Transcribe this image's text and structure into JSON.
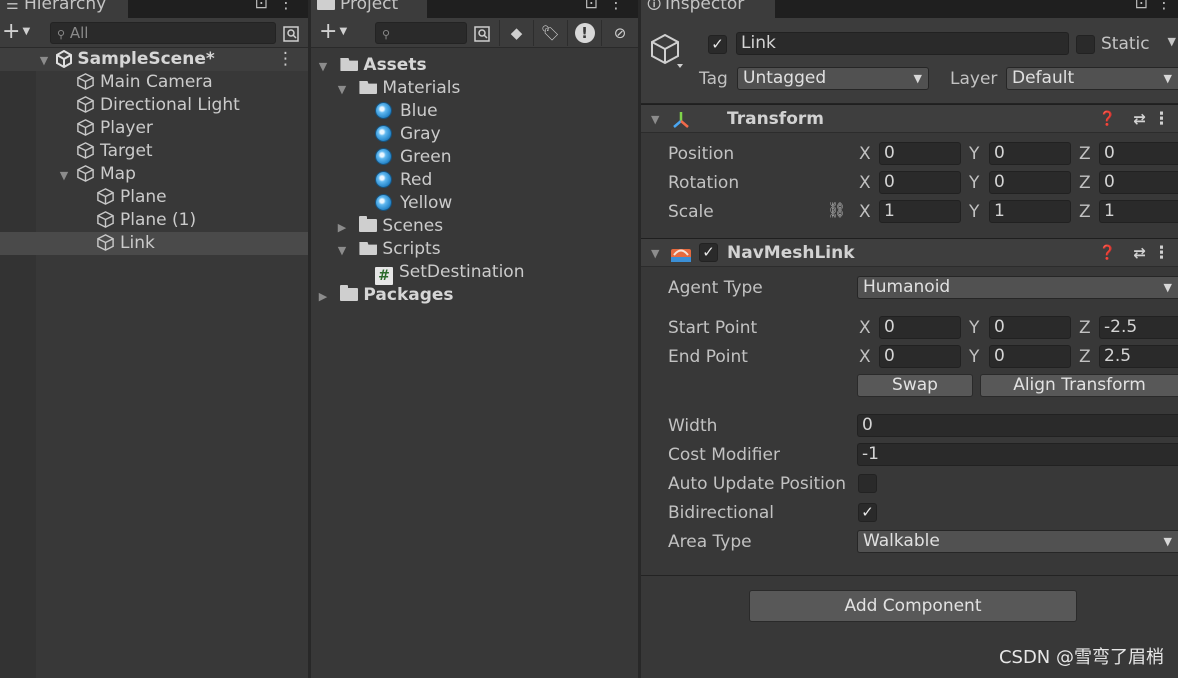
{
  "hierarchy": {
    "tab_label": "Hierarchy",
    "search_placeholder": "All",
    "scene": "SampleScene*",
    "items": [
      {
        "label": "Main Camera"
      },
      {
        "label": "Directional Light"
      },
      {
        "label": "Player"
      },
      {
        "label": "Target"
      },
      {
        "label": "Map"
      },
      {
        "label": "Plane"
      },
      {
        "label": "Plane (1)"
      },
      {
        "label": "Link"
      }
    ]
  },
  "project": {
    "tab_label": "Project",
    "assets": "Assets",
    "materials": "Materials",
    "material_items": [
      {
        "label": "Blue"
      },
      {
        "label": "Gray"
      },
      {
        "label": "Green"
      },
      {
        "label": "Red"
      },
      {
        "label": "Yellow"
      }
    ],
    "scenes": "Scenes",
    "scripts": "Scripts",
    "script_item": "SetDestination",
    "packages": "Packages"
  },
  "inspector": {
    "tab_label": "Inspector",
    "object_name": "Link",
    "static_label": "Static",
    "tag_label": "Tag",
    "tag_value": "Untagged",
    "layer_label": "Layer",
    "layer_value": "Default",
    "transform": {
      "title": "Transform",
      "position_label": "Position",
      "rotation_label": "Rotation",
      "scale_label": "Scale",
      "axis_x": "X",
      "axis_y": "Y",
      "axis_z": "Z",
      "position": [
        "0",
        "0",
        "0"
      ],
      "rotation": [
        "0",
        "0",
        "0"
      ],
      "scale": [
        "1",
        "1",
        "1"
      ]
    },
    "navmeshlink": {
      "title": "NavMeshLink",
      "agent_type_label": "Agent Type",
      "agent_type_value": "Humanoid",
      "start_point_label": "Start Point",
      "start_point": [
        "0",
        "0",
        "-2.5"
      ],
      "end_point_label": "End Point",
      "end_point": [
        "0",
        "0",
        "2.5"
      ],
      "swap_label": "Swap",
      "align_label": "Align Transform",
      "width_label": "Width",
      "width_value": "0",
      "cost_label": "Cost Modifier",
      "cost_value": "-1",
      "auto_update_label": "Auto Update Position",
      "auto_update_checked": false,
      "bidirectional_label": "Bidirectional",
      "bidirectional_checked": true,
      "area_type_label": "Area Type",
      "area_type_value": "Walkable"
    },
    "add_component_label": "Add Component"
  },
  "watermark": "CSDN @雪弯了眉梢"
}
